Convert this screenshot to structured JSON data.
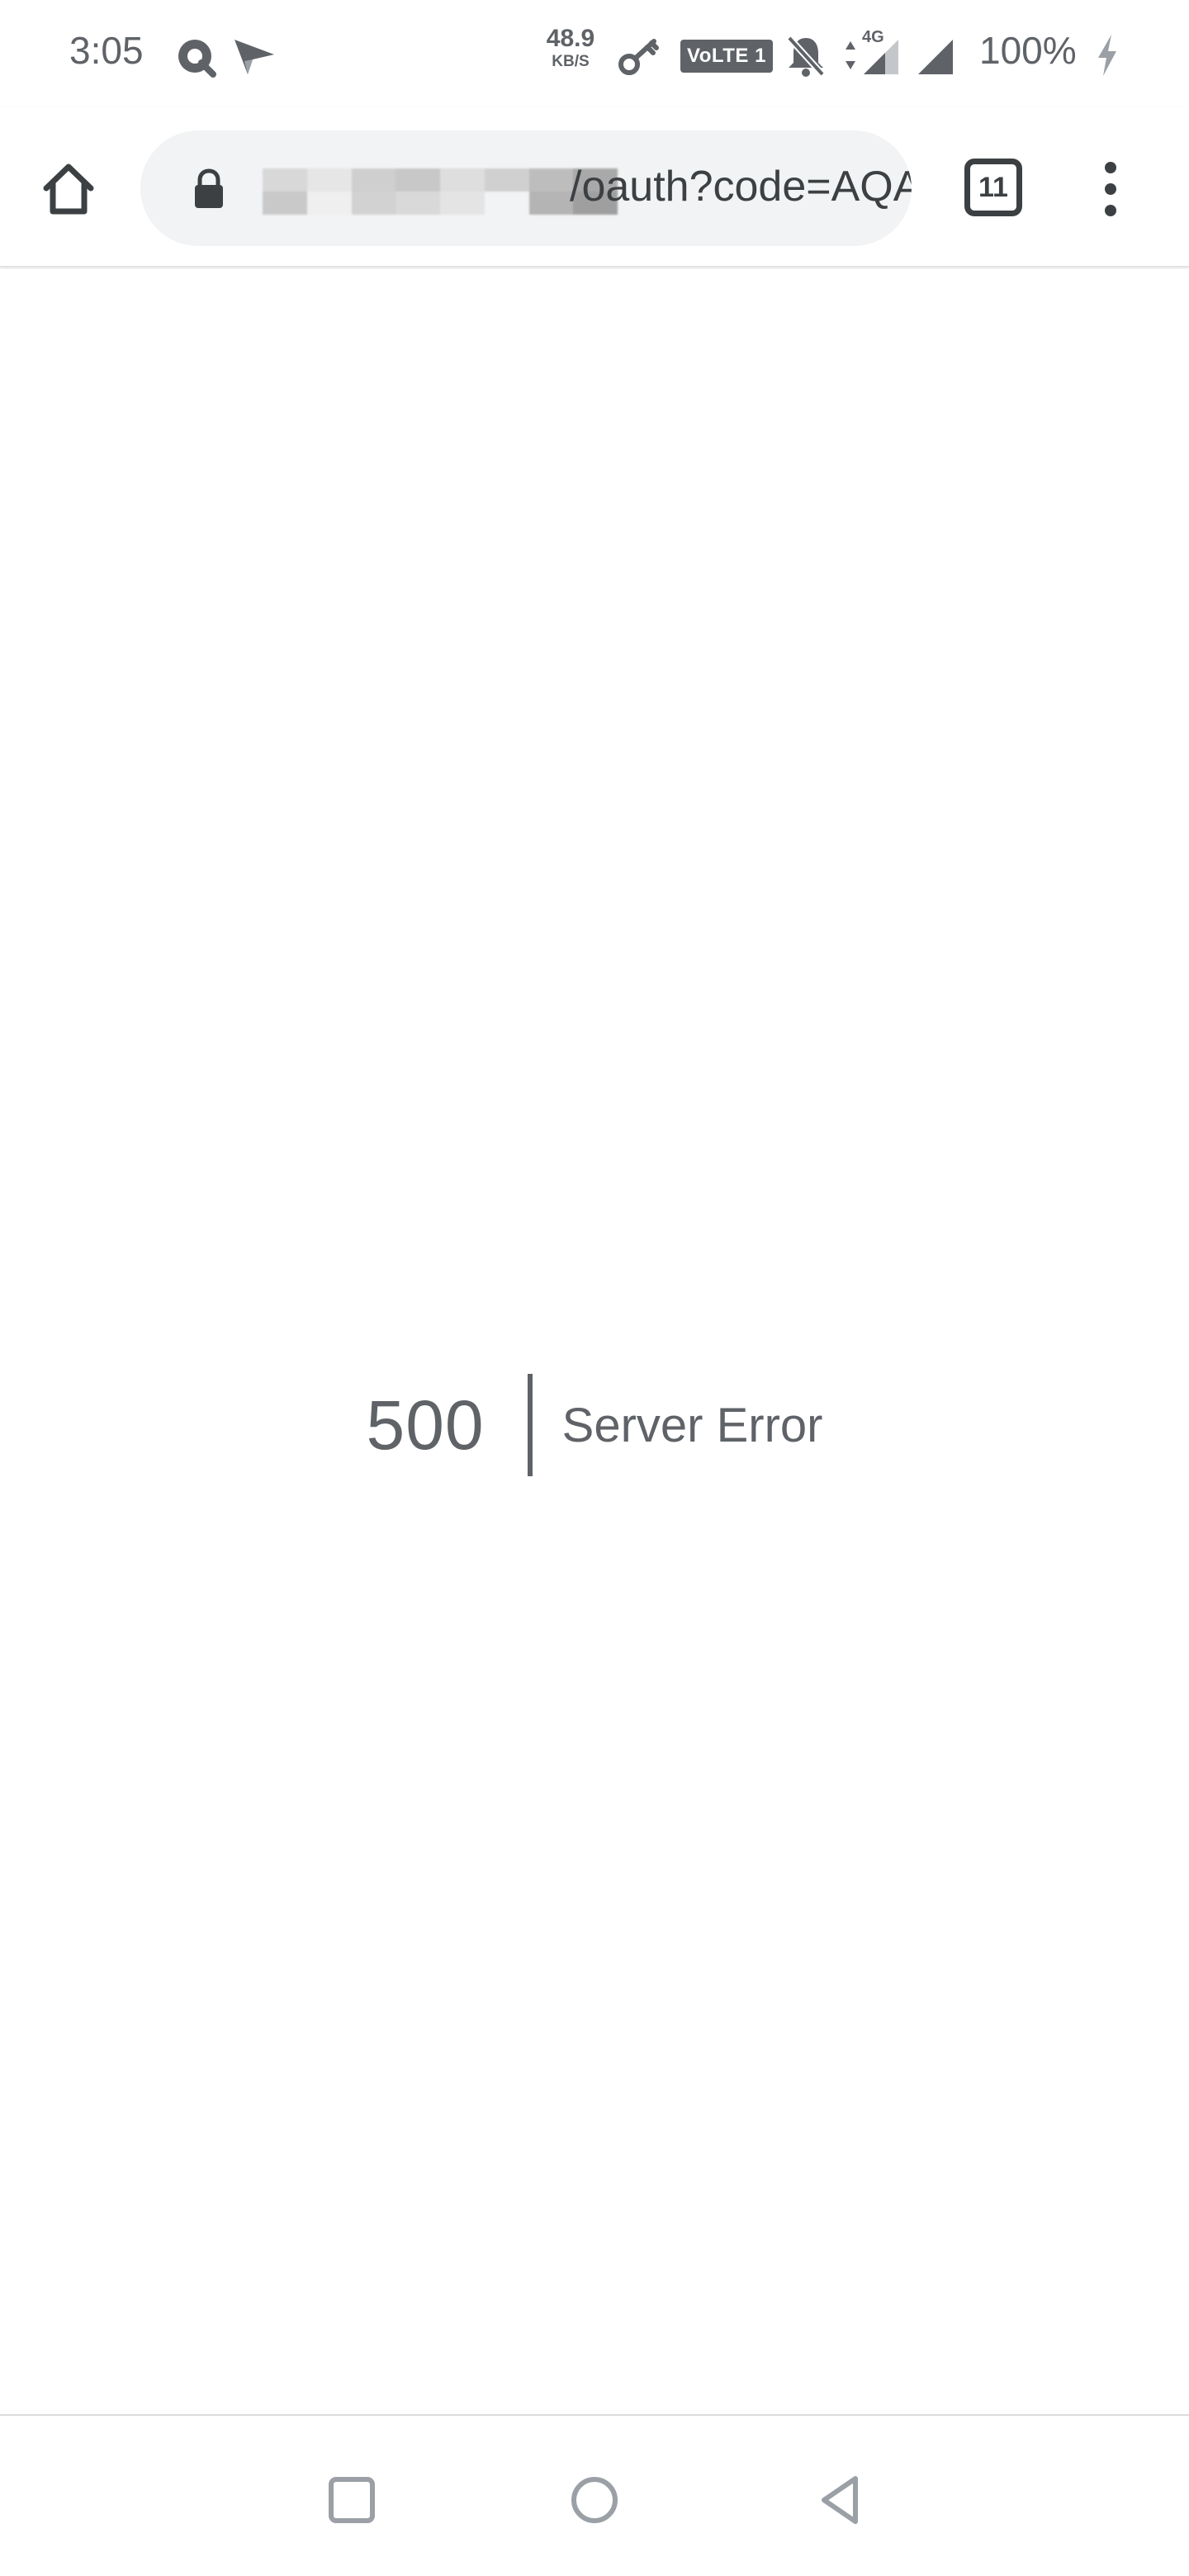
{
  "status_bar": {
    "time": "3:05",
    "net_speed_value": "48.9",
    "net_speed_unit": "KB/S",
    "volte_label": "VoLTE 1",
    "network_type": "4G",
    "battery": "100%",
    "icons": [
      "q-app-icon",
      "send-icon",
      "key-icon",
      "bell-off-icon",
      "data-arrows-icon",
      "signal-icon",
      "signal-icon",
      "charging-icon"
    ]
  },
  "browser": {
    "url_visible": "/oauth?code=AQAE",
    "tab_count": "11",
    "icons": [
      "home-icon",
      "lock-icon",
      "tab-switcher-icon",
      "more-vert-icon"
    ]
  },
  "page": {
    "error_code": "500",
    "error_message": "Server Error"
  },
  "nav": {
    "icons": [
      "recents-icon",
      "home-circle-icon",
      "back-triangle-icon"
    ]
  },
  "colors": {
    "text_gray": "#5f6368",
    "omnibox_bg": "#f1f3f4",
    "toolbar_icon": "#3c4043"
  }
}
